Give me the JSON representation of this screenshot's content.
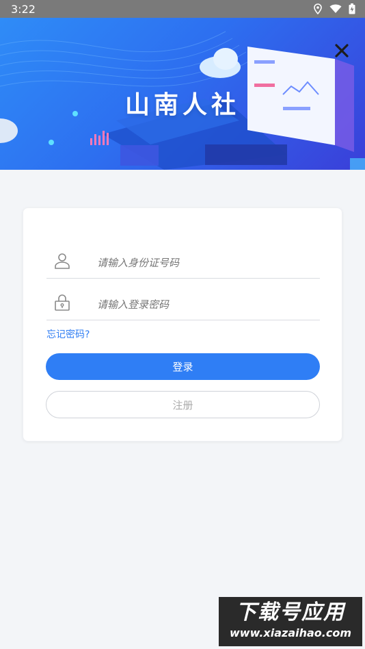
{
  "status_bar": {
    "time": "3:22"
  },
  "banner": {
    "title": "山南人社"
  },
  "login_form": {
    "id_placeholder": "请输入身份证号码",
    "password_placeholder": "请输入登录密码",
    "forgot_password": "忘记密码?",
    "login_label": "登录",
    "register_label": "注册"
  },
  "colors": {
    "primary": "#2f7ef5",
    "link": "#2f7df3",
    "background": "#f3f5f8"
  },
  "watermark": {
    "title": "下载号应用",
    "url": "www.xiazaihao.com"
  }
}
